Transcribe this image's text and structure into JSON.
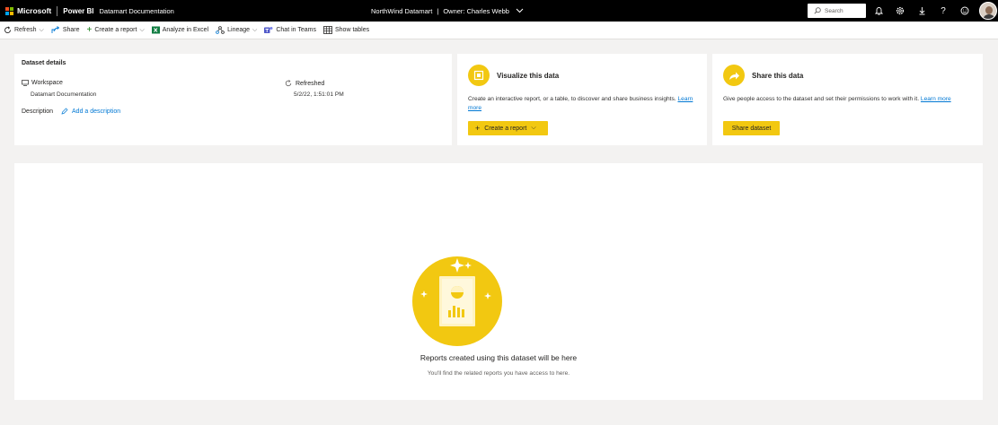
{
  "header": {
    "brand_microsoft": "Microsoft",
    "brand_app": "Power BI",
    "item_name": "Datamart Documentation",
    "center_title": "NorthWind Datamart",
    "center_separator": "|",
    "owner": "Owner: Charles Webb",
    "search_placeholder": "Search",
    "icons": [
      "bell-icon",
      "gear-icon",
      "download-icon",
      "help-icon",
      "feedback-icon"
    ],
    "logo_colors": [
      "#f25022",
      "#7fba00",
      "#00a4ef",
      "#ffb900"
    ]
  },
  "toolbar": {
    "refresh": "Refresh",
    "share": "Share",
    "create_report": "Create a report",
    "analyze_excel": "Analyze in Excel",
    "lineage": "Lineage",
    "chat_teams": "Chat in Teams",
    "show_tables": "Show tables"
  },
  "details": {
    "title": "Dataset details",
    "workspace_label": "Workspace",
    "workspace_value": "Datamart Documentation",
    "refreshed_label": "Refreshed",
    "refreshed_value": "5/2/22, 1:51:01 PM",
    "description_label": "Description",
    "add_description": "Add a description"
  },
  "visualize": {
    "title": "Visualize this data",
    "desc": "Create an interactive report, or a table, to discover and share business insights.",
    "learn_more_1": "Learn",
    "learn_more_2": "more",
    "button": "Create a report"
  },
  "share": {
    "title": "Share this data",
    "desc": "Give people access to the dataset and set their permissions to work with it.",
    "learn_more": "Learn more",
    "button": "Share dataset"
  },
  "reports": {
    "empty_title": "Reports created using this dataset will be here",
    "empty_sub": "You'll find the related reports you have access to here."
  },
  "colors": {
    "accent": "#f2c811",
    "link": "#0078d4",
    "header_bg": "#000000",
    "page_bg": "#f3f2f1"
  }
}
